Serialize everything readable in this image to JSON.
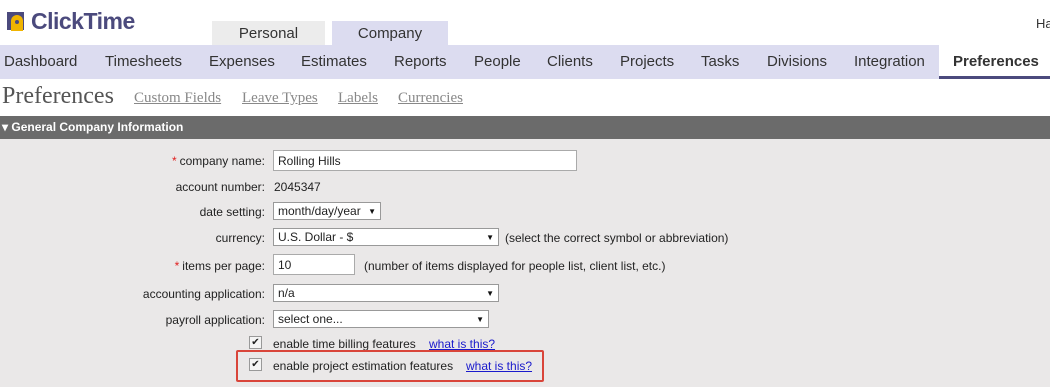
{
  "app": {
    "logo_text": "ClickTime",
    "user_initial": "Ha"
  },
  "top_tabs": [
    {
      "label": "Personal"
    },
    {
      "label": "Company"
    }
  ],
  "nav": {
    "items": [
      {
        "label": "Dashboard"
      },
      {
        "label": "Timesheets"
      },
      {
        "label": "Expenses"
      },
      {
        "label": "Estimates"
      },
      {
        "label": "Reports"
      },
      {
        "label": "People"
      },
      {
        "label": "Clients"
      },
      {
        "label": "Projects"
      },
      {
        "label": "Tasks"
      },
      {
        "label": "Divisions"
      },
      {
        "label": "Integration"
      },
      {
        "label": "Preferences"
      }
    ],
    "active": "Preferences"
  },
  "sub_header": {
    "title": "Preferences",
    "links": [
      {
        "label": "Custom Fields"
      },
      {
        "label": "Leave Types"
      },
      {
        "label": "Labels"
      },
      {
        "label": "Currencies"
      }
    ]
  },
  "section": {
    "title": "▾ General Company Information"
  },
  "form": {
    "required_marker": "*",
    "company_name": {
      "label": "company name:",
      "value": "Rolling Hills"
    },
    "account_number": {
      "label": "account number:",
      "value": "2045347"
    },
    "date_setting": {
      "label": "date setting:",
      "value": "month/day/year"
    },
    "currency": {
      "label": "currency:",
      "value": "U.S. Dollar - $",
      "hint": "(select the correct symbol or abbreviation)"
    },
    "items_per_page": {
      "label": "items per page:",
      "value": "10",
      "hint": "(number of items displayed for people list, client list, etc.)"
    },
    "accounting_application": {
      "label": "accounting application:",
      "value": "n/a"
    },
    "payroll_application": {
      "label": "payroll application:",
      "value": "select one..."
    },
    "time_billing": {
      "label": "enable time billing features",
      "checked": true,
      "link": "what is this?"
    },
    "project_estimation": {
      "label": "enable project estimation features",
      "checked": true,
      "link": "what is this?"
    }
  },
  "colors": {
    "brand": "#4b4a7d",
    "nav_bg": "#dcdcf0",
    "section_bar": "#6b6b6b",
    "form_bg": "#eae8e8",
    "highlight": "#d9453a",
    "link": "#1a1acc",
    "required": "#e02020"
  }
}
